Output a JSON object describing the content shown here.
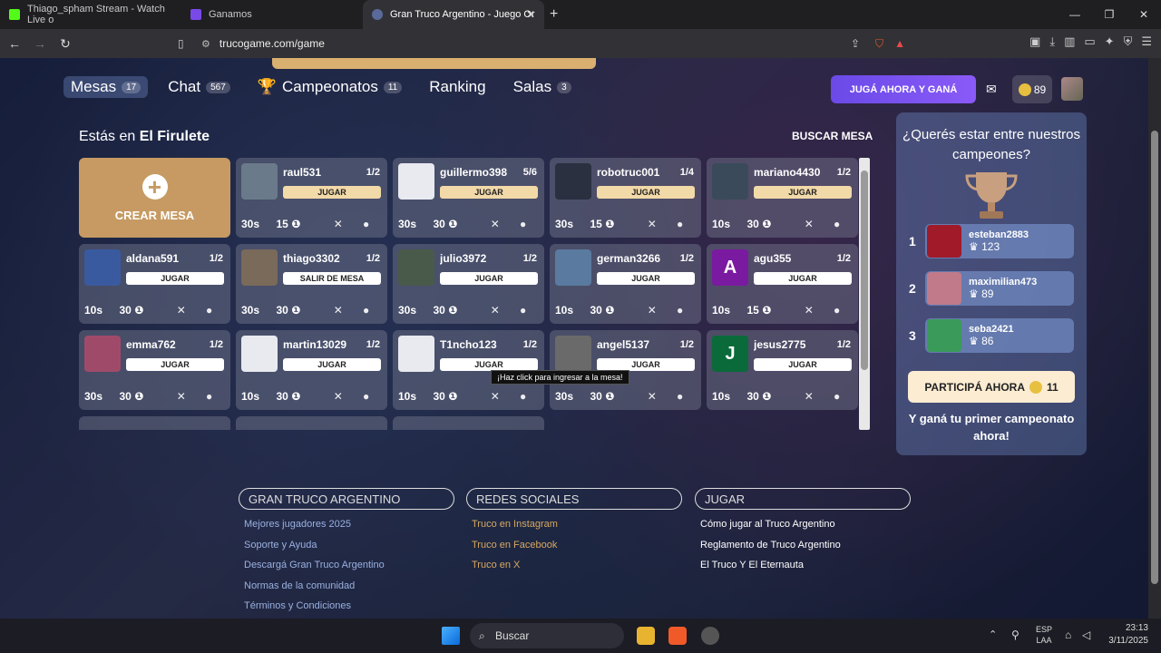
{
  "browser": {
    "tabs": [
      {
        "label": "Thiago_spham Stream - Watch Live o",
        "color": "#53fc18"
      },
      {
        "label": "Ganamos",
        "color": "#7a4ae8"
      },
      {
        "label": "Gran Truco Argentino - Juego Or",
        "color": "#5a6a9a",
        "active": true
      }
    ],
    "url": "trucogame.com/game"
  },
  "nav": {
    "items": [
      {
        "label": "Mesas",
        "badge": "17",
        "active": true
      },
      {
        "label": "Chat",
        "badge": "567"
      },
      {
        "label": "Campeonatos",
        "badge": "11"
      },
      {
        "label": "Ranking",
        "badge": ""
      },
      {
        "label": "Salas",
        "badge": "3"
      }
    ],
    "play_label": "JUGÁ AHORA Y GANÁ",
    "coins": "89"
  },
  "lobby": {
    "location_prefix": "Estás en",
    "location_name": "El Firulete",
    "search_label": "BUSCAR MESA",
    "create_label": "CREAR MESA",
    "tooltip": "¡Haz click para ingresar a la mesa!",
    "tables": [
      {
        "name": "raul531",
        "count": "1/2",
        "btn": "JUGAR",
        "time": "30s",
        "points": "15",
        "pic": "#6a7a8a"
      },
      {
        "name": "guillermo398",
        "count": "5/6",
        "btn": "JUGAR",
        "time": "30s",
        "points": "30",
        "pic": "#e8eaf0"
      },
      {
        "name": "robotruc001",
        "count": "1/4",
        "btn": "JUGAR",
        "time": "30s",
        "points": "15",
        "pic": "#2a3040"
      },
      {
        "name": "mariano4430",
        "count": "1/2",
        "btn": "JUGAR",
        "time": "10s",
        "points": "30",
        "pic": "#3a4a5a"
      },
      {
        "name": "aldana591",
        "count": "1/2",
        "btn": "JUGAR",
        "time": "10s",
        "points": "30",
        "pic": "#3a5aa0"
      },
      {
        "name": "thiago3302",
        "count": "1/2",
        "btn": "SALIR DE MESA",
        "time": "30s",
        "points": "30",
        "pic": "#7a6a5a"
      },
      {
        "name": "julio3972",
        "count": "1/2",
        "btn": "JUGAR",
        "time": "30s",
        "points": "30",
        "pic": "#4a5a4a"
      },
      {
        "name": "german3266",
        "count": "1/2",
        "btn": "JUGAR",
        "time": "10s",
        "points": "30",
        "pic": "#5a7aa0"
      },
      {
        "name": "agu355",
        "count": "1/2",
        "btn": "JUGAR",
        "time": "10s",
        "points": "15",
        "pic": "#7a1aa0",
        "initial": "A"
      },
      {
        "name": "emma762",
        "count": "1/2",
        "btn": "JUGAR",
        "time": "30s",
        "points": "30",
        "pic": "#a04a6a"
      },
      {
        "name": "martin13029",
        "count": "1/2",
        "btn": "JUGAR",
        "time": "10s",
        "points": "30",
        "pic": "#e8eaf0"
      },
      {
        "name": "T1ncho123",
        "count": "1/2",
        "btn": "JUGAR",
        "time": "10s",
        "points": "30",
        "pic": "#e8eaf0"
      },
      {
        "name": "angel5137",
        "count": "1/2",
        "btn": "JUGAR",
        "time": "30s",
        "points": "30",
        "pic": "#6a6a6a"
      },
      {
        "name": "jesus2775",
        "count": "1/2",
        "btn": "JUGAR",
        "time": "10s",
        "points": "30",
        "pic": "#0a6a3a",
        "initial": "J"
      }
    ]
  },
  "sidebar": {
    "question": "¿Querés estar entre nuestros campeones?",
    "ranking": [
      {
        "pos": "1",
        "name": "esteban2883",
        "pts": "123",
        "pic": "#a01a2a"
      },
      {
        "pos": "2",
        "name": "maximilian473",
        "pts": "89",
        "pic": "#c07a8a"
      },
      {
        "pos": "3",
        "name": "seba2421",
        "pts": "86",
        "pic": "#3a9a5a"
      }
    ],
    "cta_label": "PARTICIPÁ AHORA",
    "cta_coins": "11",
    "bottom_text": "Y ganá tu primer campeonato ahora!"
  },
  "footer": {
    "col1": {
      "title": "GRAN TRUCO ARGENTINO",
      "links": [
        "Mejores jugadores 2025",
        "Soporte y Ayuda",
        "Descargá Gran Truco Argentino",
        "Normas de la comunidad",
        "Términos y Condiciones"
      ]
    },
    "col2": {
      "title": "REDES SOCIALES",
      "links": [
        "Truco en Instagram",
        "Truco en Facebook",
        "Truco en X"
      ]
    },
    "col3": {
      "title": "JUGAR",
      "links": [
        "Cómo jugar al Truco Argentino",
        "Reglamento de Truco Argentino",
        "El Truco Y El Eternauta"
      ]
    }
  },
  "taskbar": {
    "search": "Buscar",
    "lang1": "ESP",
    "lang2": "LAA",
    "time": "23:13",
    "date": "3/11/2025"
  }
}
